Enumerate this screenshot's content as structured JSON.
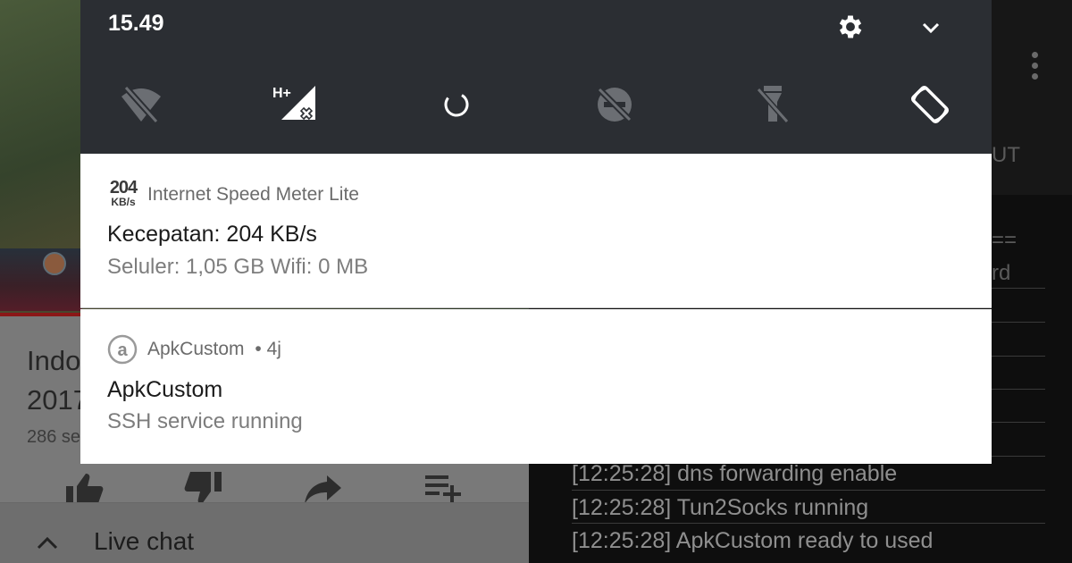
{
  "background_youtube": {
    "title_lines": [
      "Indo",
      "2017"
    ],
    "views": "286 se",
    "chat_label": "Live chat"
  },
  "background_apkcustom": {
    "tab_partial": "UT",
    "partial_lines": [
      "==",
      "rd"
    ],
    "log_lines": [
      "[12:25:28] dns forwarding enable",
      "[12:25:28] Tun2Socks running",
      "[12:25:28] ApkCustom ready to used"
    ]
  },
  "quick_settings": {
    "time": "15.49",
    "network_badge": "H+",
    "tiles": [
      "wifi-off-icon",
      "mobile-data-icon",
      "loading-icon",
      "do-not-disturb-off-icon",
      "flashlight-off-icon",
      "auto-rotate-icon"
    ]
  },
  "notifications": [
    {
      "app_name": "Internet Speed Meter Lite",
      "badge_value": "204",
      "badge_unit": "KB/s",
      "title": "Kecepatan: 204 KB/s",
      "text": "Seluler: 1,05 GB   Wifi: 0 MB"
    },
    {
      "app_name": "ApkCustom",
      "time": "• 4j",
      "title": "ApkCustom",
      "text": "SSH service running"
    }
  ],
  "colors": {
    "shade_header": "#2b2e33",
    "notification_bg": "#ffffff",
    "progress_red": "#8b1717"
  }
}
